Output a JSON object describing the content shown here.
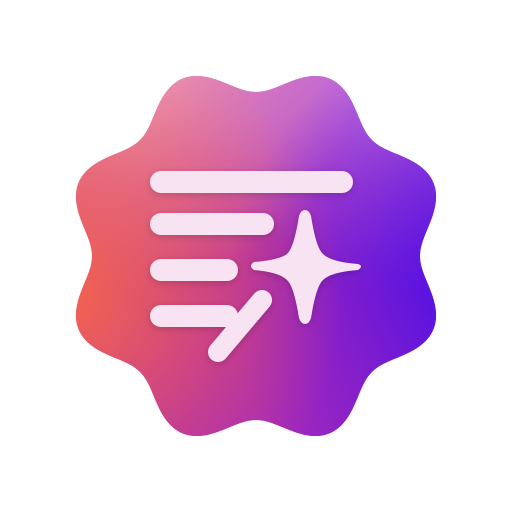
{
  "icon": {
    "badge_icon": "wavy-badge-icon",
    "glyph_icon": "text-lines-sparkle-icon",
    "lines_icon": "text-lines-icon",
    "sparkle_icon": "four-point-star-icon",
    "wand_icon": "magic-wand-icon"
  },
  "colors": {
    "gradient_top_left": "#f0a0b8",
    "gradient_left": "#f4644c",
    "gradient_center": "#b02ab0",
    "gradient_right": "#5a18e0",
    "gradient_top_right": "#c070e0",
    "gradient_bottom": "#a020a0",
    "glyph": "#f7e3f2"
  }
}
